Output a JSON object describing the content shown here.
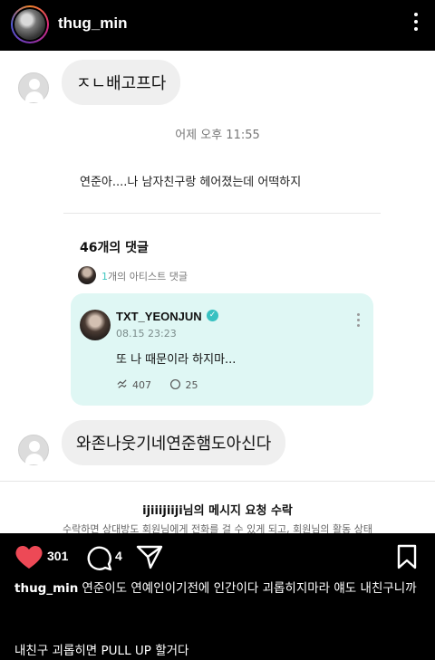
{
  "post": {
    "username": "thug_min",
    "likes": "301",
    "comments": "4",
    "caption_user": "thug_min",
    "caption_text": "연준이도 연예인이기전에 인간이다 괴롭히지마라 얘도 내친구니까",
    "caption_line2": "내친구 괴롭히면 PULL UP 할거다"
  },
  "screenshot": {
    "bubble1": "ㅈㄴ배고프다",
    "timestamp": "어제 오후 11:55",
    "shared_message": "연준아....나 남자친구랑 헤어졌는데 어떡하지",
    "comment_count": "46개의 댓글",
    "artist_count": "1",
    "artist_label": "개의 아티스트 댓글",
    "card": {
      "name": "TXT_YEONJUN",
      "date": "08.15 23:23",
      "body": "또 나 때문이라 하지마...",
      "likes": "407",
      "replies": "25"
    },
    "bubble2": "와존나웃기네연준햄도아신다",
    "request_title": "ijiiijiiji님의 메시지 요청 수락",
    "request_sub": "수락하면 상대방도 회원님에게 전화를 걸 수 있게 되고, 회원님의 활동 상태"
  },
  "colors": {
    "card_bg": "#dff7f4",
    "accent": "#41c7c0",
    "like_red": "#ed4956"
  },
  "icons": [
    "more-vert-icon",
    "verified-icon",
    "heart-icon",
    "comment-icon",
    "share-icon",
    "bookmark-icon"
  ]
}
